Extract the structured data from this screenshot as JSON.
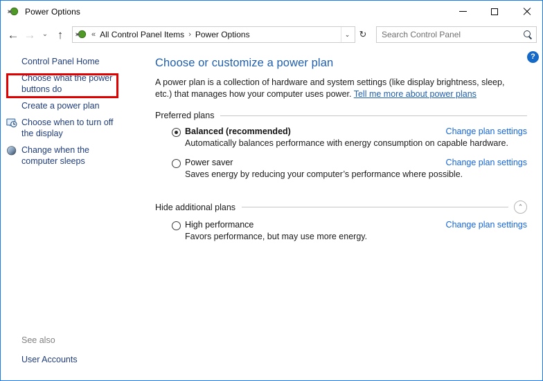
{
  "window": {
    "title": "Power Options",
    "icon": "power-plug-icon",
    "controls": {
      "minimize": "minimize-button",
      "maximize": "maximize-button",
      "close": "close-button"
    }
  },
  "navbar": {
    "back": "←",
    "forward": "→",
    "recent": "⌄",
    "up": "↑",
    "breadcrumb": {
      "icon": "power-plug-icon",
      "overflow": "«",
      "items": [
        "All Control Panel Items",
        "Power Options"
      ],
      "separator": "›"
    },
    "address_dropdown": "⌄",
    "refresh": "↻",
    "search": {
      "placeholder": "Search Control Panel",
      "value": "",
      "icon": "search-icon"
    }
  },
  "sidebar": {
    "items": [
      {
        "label": "Control Panel Home",
        "icon": null,
        "highlighted": false
      },
      {
        "label": "Choose what the power buttons do",
        "icon": null,
        "highlighted": true
      },
      {
        "label": "Create a power plan",
        "icon": null,
        "highlighted": false
      },
      {
        "label": "Choose when to turn off the display",
        "icon": "display-clock-icon",
        "highlighted": false
      },
      {
        "label": "Change when the computer sleeps",
        "icon": "moon-sleep-icon",
        "highlighted": false
      }
    ],
    "see_also": {
      "label": "See also",
      "links": [
        "User Accounts"
      ]
    },
    "highlight_color": "#e00000"
  },
  "main": {
    "help_button": "?",
    "title": "Choose or customize a power plan",
    "description_text": "A power plan is a collection of hardware and system settings (like display brightness, sleep, etc.) that manages how your computer uses power.",
    "description_link": "Tell me more about power plans",
    "groups": [
      {
        "title": "Preferred plans",
        "collapse_icon": null,
        "plans": [
          {
            "name": "Balanced (recommended)",
            "selected": true,
            "bold": true,
            "description": "Automatically balances performance with energy consumption on capable hardware.",
            "action": "Change plan settings"
          },
          {
            "name": "Power saver",
            "selected": false,
            "bold": false,
            "description": "Saves energy by reducing your computer’s performance where possible.",
            "action": "Change plan settings"
          }
        ]
      },
      {
        "title": "Hide additional plans",
        "collapse_icon": "⌃",
        "plans": [
          {
            "name": "High performance",
            "selected": false,
            "bold": false,
            "description": "Favors performance, but may use more energy.",
            "action": "Change plan settings"
          }
        ]
      }
    ]
  },
  "colors": {
    "window_border": "#1a7ce8",
    "link_blue": "#1565d8",
    "title_blue": "#1f5fae",
    "sidebar_link": "#1f3c7a",
    "highlight_red": "#e00000"
  }
}
